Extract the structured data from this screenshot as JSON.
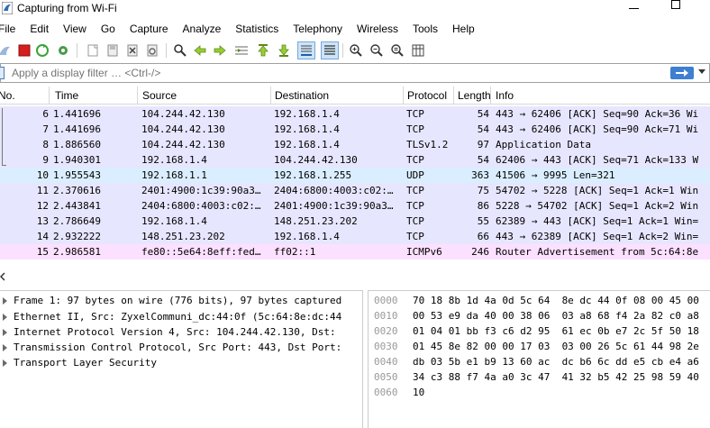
{
  "window": {
    "title": "Capturing from Wi-Fi"
  },
  "menu": [
    "File",
    "Edit",
    "View",
    "Go",
    "Capture",
    "Analyze",
    "Statistics",
    "Telephony",
    "Wireless",
    "Tools",
    "Help"
  ],
  "filter": {
    "placeholder": "Apply a display filter … <Ctrl-/>"
  },
  "packet_list": {
    "columns": [
      "No.",
      "Time",
      "Source",
      "Destination",
      "Protocol",
      "Length",
      "Info"
    ],
    "rows": [
      {
        "no": "6",
        "time": "1.441696",
        "src": "104.244.42.130",
        "dst": "192.168.1.4",
        "proto": "TCP",
        "len": "54",
        "info": "443 → 62406 [ACK] Seq=90 Ack=36 Wi",
        "type": "tcp"
      },
      {
        "no": "7",
        "time": "1.441696",
        "src": "104.244.42.130",
        "dst": "192.168.1.4",
        "proto": "TCP",
        "len": "54",
        "info": "443 → 62406 [ACK] Seq=90 Ack=71 Wi",
        "type": "tcp"
      },
      {
        "no": "8",
        "time": "1.886560",
        "src": "104.244.42.130",
        "dst": "192.168.1.4",
        "proto": "TLSv1.2",
        "len": "97",
        "info": "Application Data",
        "type": "tcp"
      },
      {
        "no": "9",
        "time": "1.940301",
        "src": "192.168.1.4",
        "dst": "104.244.42.130",
        "proto": "TCP",
        "len": "54",
        "info": "62406 → 443 [ACK] Seq=71 Ack=133 W",
        "type": "tcp"
      },
      {
        "no": "10",
        "time": "1.955543",
        "src": "192.168.1.1",
        "dst": "192.168.1.255",
        "proto": "UDP",
        "len": "363",
        "info": "41506 → 9995 Len=321",
        "type": "udp"
      },
      {
        "no": "11",
        "time": "2.370616",
        "src": "2401:4900:1c39:90a3…",
        "dst": "2404:6800:4003:c02:…",
        "proto": "TCP",
        "len": "75",
        "info": "54702 → 5228 [ACK] Seq=1 Ack=1 Win",
        "type": "tcp"
      },
      {
        "no": "12",
        "time": "2.443841",
        "src": "2404:6800:4003:c02:…",
        "dst": "2401:4900:1c39:90a3…",
        "proto": "TCP",
        "len": "86",
        "info": "5228 → 54702 [ACK] Seq=1 Ack=2 Win",
        "type": "tcp"
      },
      {
        "no": "13",
        "time": "2.786649",
        "src": "192.168.1.4",
        "dst": "148.251.23.202",
        "proto": "TCP",
        "len": "55",
        "info": "62389 → 443 [ACK] Seq=1 Ack=1 Win=",
        "type": "tcp"
      },
      {
        "no": "14",
        "time": "2.932222",
        "src": "148.251.23.202",
        "dst": "192.168.1.4",
        "proto": "TCP",
        "len": "66",
        "info": "443 → 62389 [ACK] Seq=1 Ack=2 Win=",
        "type": "tcp"
      },
      {
        "no": "15",
        "time": "2.986581",
        "src": "fe80::5e64:8eff:fed…",
        "dst": "ff02::1",
        "proto": "ICMPv6",
        "len": "246",
        "info": "Router Advertisement from 5c:64:8e",
        "type": "icmp"
      }
    ]
  },
  "details": [
    "Frame 1: 97 bytes on wire (776 bits), 97 bytes captured",
    "Ethernet II, Src: ZyxelCommuni_dc:44:0f (5c:64:8e:dc:44",
    "Internet Protocol Version 4, Src: 104.244.42.130, Dst:",
    "Transmission Control Protocol, Src Port: 443, Dst Port:",
    "Transport Layer Security"
  ],
  "bytes": [
    {
      "off": "0000",
      "hex": "70 18 8b 1d 4a 0d 5c 64  8e dc 44 0f 08 00 45 00"
    },
    {
      "off": "0010",
      "hex": "00 53 e9 da 40 00 38 06  03 a8 68 f4 2a 82 c0 a8"
    },
    {
      "off": "0020",
      "hex": "01 04 01 bb f3 c6 d2 95  61 ec 0b e7 2c 5f 50 18"
    },
    {
      "off": "0030",
      "hex": "01 45 8e 82 00 00 17 03  03 00 26 5c 61 44 98 2e"
    },
    {
      "off": "0040",
      "hex": "db 03 5b e1 b9 13 60 ac  dc b6 6c dd e5 cb e4 a6"
    },
    {
      "off": "0050",
      "hex": "34 c3 88 f7 4a a0 3c 47  41 32 b5 42 25 98 59 40"
    },
    {
      "off": "0060",
      "hex": "10"
    }
  ],
  "colors": {
    "tcp_row": "#e7e6ff",
    "udp_row": "#daeeff",
    "icmp_row": "#fce0ff",
    "stop_button": "#d42020",
    "shark_fin": "#2d6db5",
    "restart": "#3aa33a"
  },
  "icons": {
    "toolbar": [
      "shark-fin-icon",
      "stop-icon",
      "restart-icon",
      "options-icon",
      "open-icon",
      "save-icon",
      "close-file-icon",
      "reload-icon",
      "find-icon",
      "back-icon",
      "forward-icon",
      "goto-packet-icon",
      "first-packet-icon",
      "last-packet-icon",
      "autoscroll-icon",
      "colorize-icon",
      "zoom-in-icon",
      "zoom-out-icon",
      "normal-size-icon",
      "resize-columns-icon"
    ]
  }
}
